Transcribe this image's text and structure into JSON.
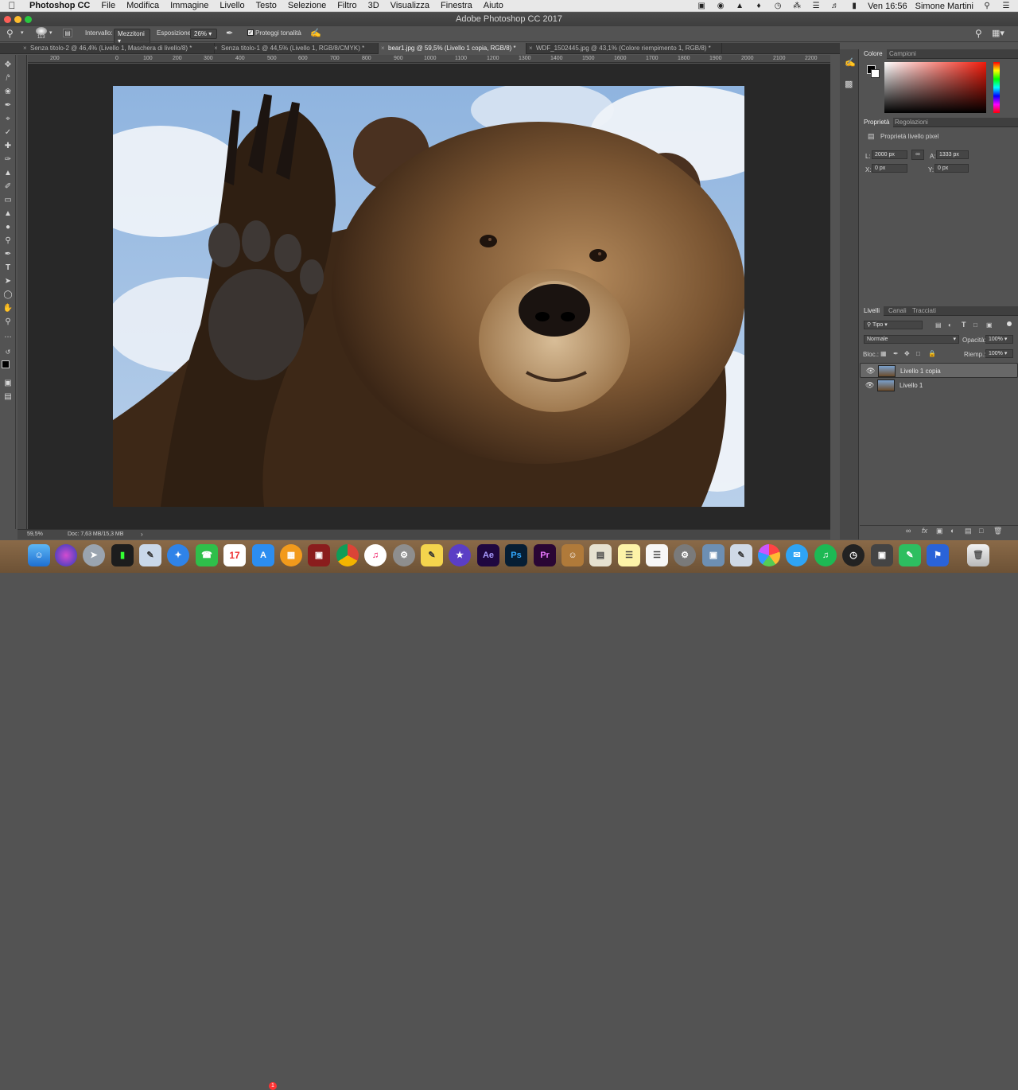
{
  "menubar": {
    "app": "Photoshop CC",
    "items": [
      "File",
      "Modifica",
      "Immagine",
      "Livello",
      "Testo",
      "Selezione",
      "Filtro",
      "3D",
      "Visualizza",
      "Finestra",
      "Aiuto"
    ],
    "clock": "Ven 16:56",
    "user": "Simone Martini"
  },
  "window": {
    "title": "Adobe Photoshop CC 2017"
  },
  "options": {
    "brush_size": "113",
    "range_label": "Intervallo:",
    "range_value": "Mezzitoni",
    "exposure_label": "Esposizione:",
    "exposure_value": "26%",
    "protect_label": "Proteggi tonalità"
  },
  "tabs": [
    {
      "label": "Senza titolo-2 @ 46,4% (Livello 1, Maschera di livello/8) *"
    },
    {
      "label": "Senza titolo-1 @ 44,5% (Livello 1, RGB/8/CMYK) *"
    },
    {
      "label": "bear1.jpg @ 59,5% (Livello 1 copia, RGB/8) *",
      "active": true
    },
    {
      "label": "WDF_1502445.jpg @ 43,1% (Colore riempimento 1, RGB/8) *"
    }
  ],
  "ruler": [
    "200",
    "0",
    "100",
    "200",
    "300",
    "400",
    "500",
    "600",
    "700",
    "800",
    "900",
    "1000",
    "1100",
    "1200",
    "1300",
    "1400",
    "1500",
    "1600",
    "1700",
    "1800",
    "1900",
    "2000",
    "2100",
    "2200"
  ],
  "status": {
    "zoom": "59,5%",
    "doc": "Doc: 7,63 MB/15,3 MB"
  },
  "color_panel": {
    "tabs": [
      "Colore",
      "Campioni"
    ]
  },
  "properties": {
    "tabs": [
      "Proprietà",
      "Regolazioni"
    ],
    "heading": "Proprietà livello pixel",
    "w_label": "L:",
    "w_value": "2000 px",
    "h_label": "A:",
    "h_value": "1333 px",
    "x_label": "X:",
    "x_value": "0 px",
    "y_label": "Y:",
    "y_value": "0 px"
  },
  "layers": {
    "tabs": [
      "Livelli",
      "Canali",
      "Tracciati"
    ],
    "filter": "Tipo",
    "blend": "Normale",
    "opacity_label": "Opacità:",
    "opacity_value": "100%",
    "lock_label": "Bloc.:",
    "fill_label": "Riemp.:",
    "fill_value": "100%",
    "items": [
      {
        "name": "Livello 1 copia",
        "selected": true
      },
      {
        "name": "Livello 1",
        "selected": false
      }
    ]
  },
  "dock": [
    "Finder",
    "Siri",
    "Launchpad",
    "Terminal",
    "Preview",
    "Safari",
    "FaceTime",
    "Calendar",
    "App Store",
    "iBooks",
    "Photo Booth",
    "Chrome",
    "iTunes",
    "System Preferences",
    "Stickies",
    "iMovie",
    "Ae",
    "Ps",
    "Pr",
    "Contacts",
    "Keynote",
    "Notes",
    "Lists",
    "Automator",
    "Display",
    "Preview 2",
    "Photos",
    "Messages",
    "Spotify",
    "Dashboard",
    "Migration",
    "Evernote",
    "Airdrop",
    "Trash"
  ],
  "dock_labels": {
    "ae": "Ae",
    "ps": "Ps",
    "pr": "Pr",
    "calendar_day": "17",
    "badge": "1"
  },
  "colors": {
    "accent": "#2d8ceb",
    "panel": "#535353",
    "canvas": "#282828"
  }
}
